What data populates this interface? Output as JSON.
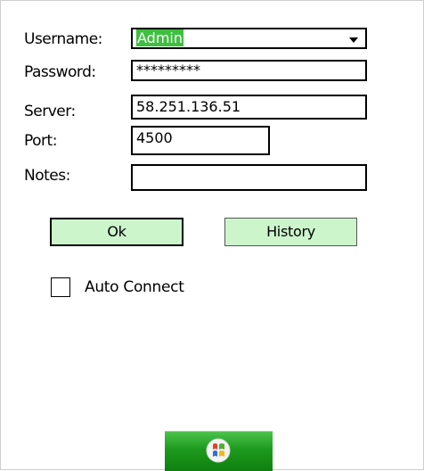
{
  "form": {
    "username_label": "Username:",
    "username_value": "Admin",
    "password_label": "Password:",
    "password_value": "*********",
    "server_label": "Server:",
    "server_value": "58.251.136.51",
    "port_label": "Port:",
    "port_value": "4500",
    "notes_label": "Notes:",
    "notes_value": ""
  },
  "buttons": {
    "ok_label": "Ok",
    "history_label": "History"
  },
  "options": {
    "auto_connect_label": "Auto Connect",
    "auto_connect_checked": false
  },
  "taskbar": {
    "start_icon": "windows-flag-icon"
  },
  "colors": {
    "button_fill": "#ccf5cc",
    "selection": "#3fbf3f",
    "start_green": "#1d9a1d"
  }
}
